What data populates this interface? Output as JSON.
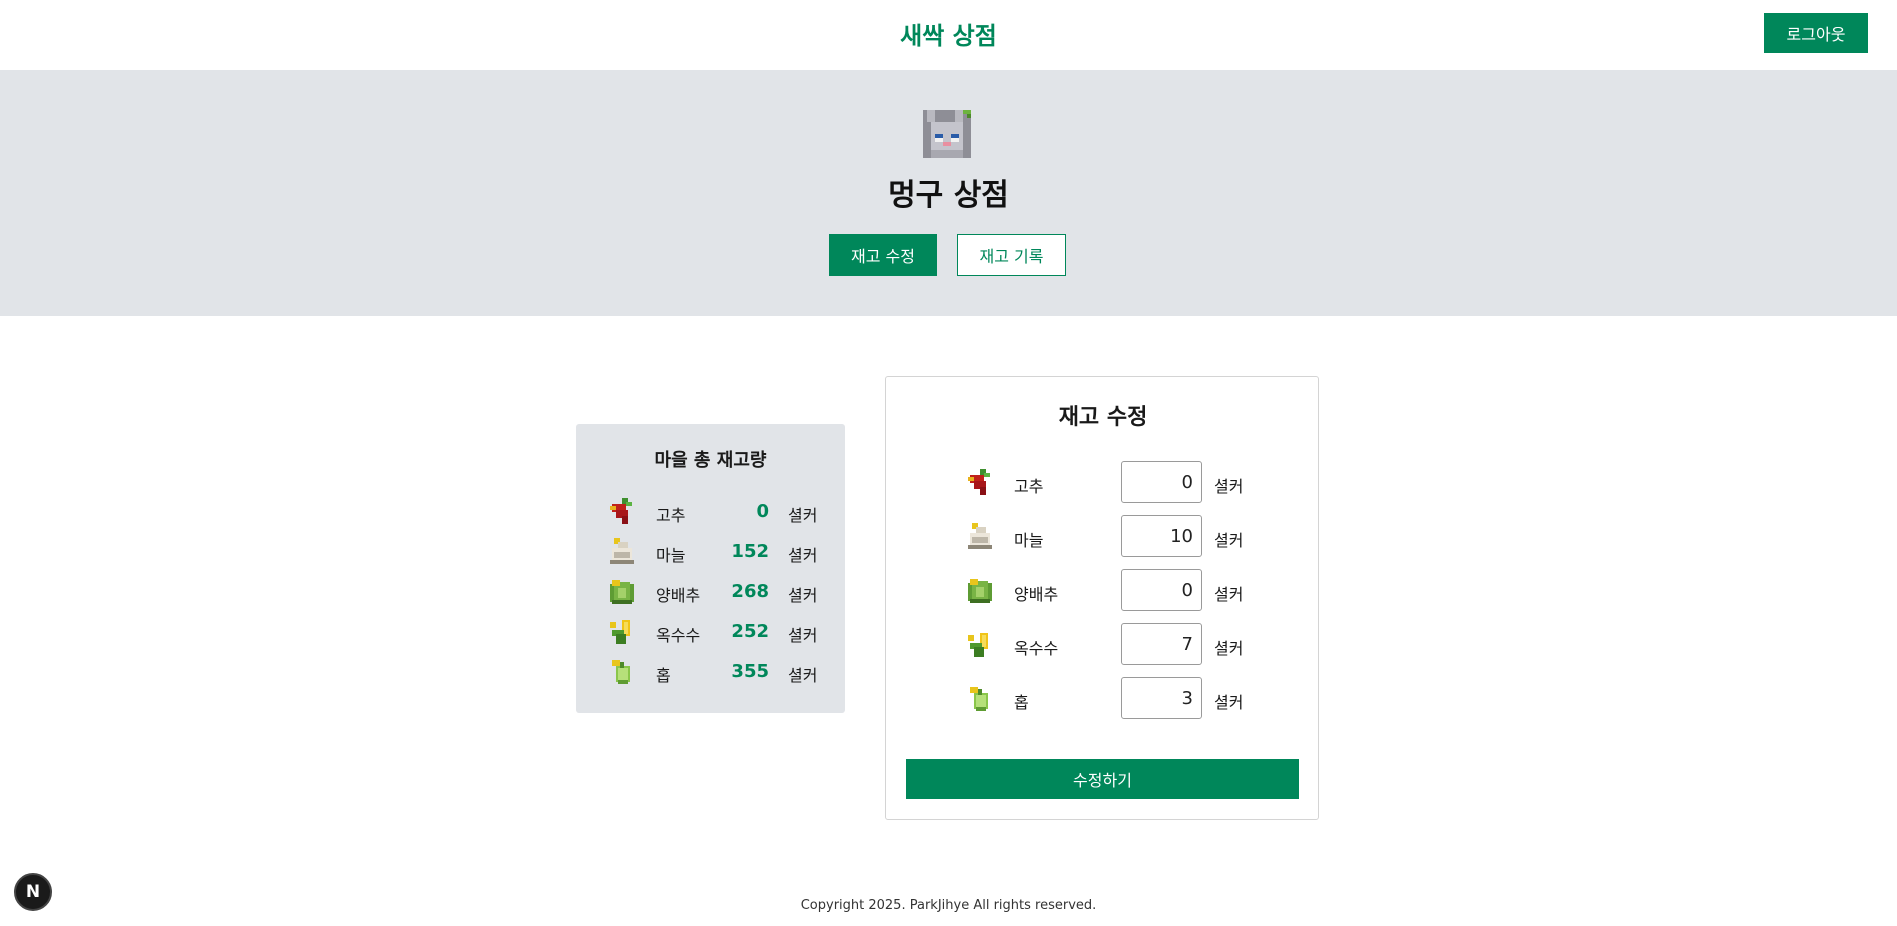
{
  "header": {
    "title": "새싹 상점",
    "logout_label": "로그아웃"
  },
  "banner": {
    "shop_name": "멍구 상점",
    "tab_edit_label": "재고 수정",
    "tab_history_label": "재고 기록"
  },
  "total_stock": {
    "title": "마을 총 재고량",
    "items": [
      {
        "icon": "pepper-icon",
        "name": "고추",
        "qty": "0",
        "unit": "셜커"
      },
      {
        "icon": "garlic-icon",
        "name": "마늘",
        "qty": "152",
        "unit": "셜커"
      },
      {
        "icon": "cabbage-icon",
        "name": "양배추",
        "qty": "268",
        "unit": "셜커"
      },
      {
        "icon": "corn-icon",
        "name": "옥수수",
        "qty": "252",
        "unit": "셜커"
      },
      {
        "icon": "hops-icon",
        "name": "홉",
        "qty": "355",
        "unit": "셜커"
      }
    ]
  },
  "edit_stock": {
    "title": "재고 수정",
    "items": [
      {
        "icon": "pepper-icon",
        "name": "고추",
        "value": "0",
        "unit": "셜커"
      },
      {
        "icon": "garlic-icon",
        "name": "마늘",
        "value": "10",
        "unit": "셜커"
      },
      {
        "icon": "cabbage-icon",
        "name": "양배추",
        "value": "0",
        "unit": "셜커"
      },
      {
        "icon": "corn-icon",
        "name": "옥수수",
        "value": "7",
        "unit": "셜커"
      },
      {
        "icon": "hops-icon",
        "name": "홉",
        "value": "3",
        "unit": "셜커"
      }
    ],
    "submit_label": "수정하기"
  },
  "footer": {
    "copyright": "Copyright 2025. ParkJihye All rights reserved."
  },
  "dev_badge": {
    "label": "N"
  },
  "colors": {
    "accent": "#00875a",
    "banner_bg": "#e1e4e8",
    "card_bg": "#e1e4e8"
  }
}
